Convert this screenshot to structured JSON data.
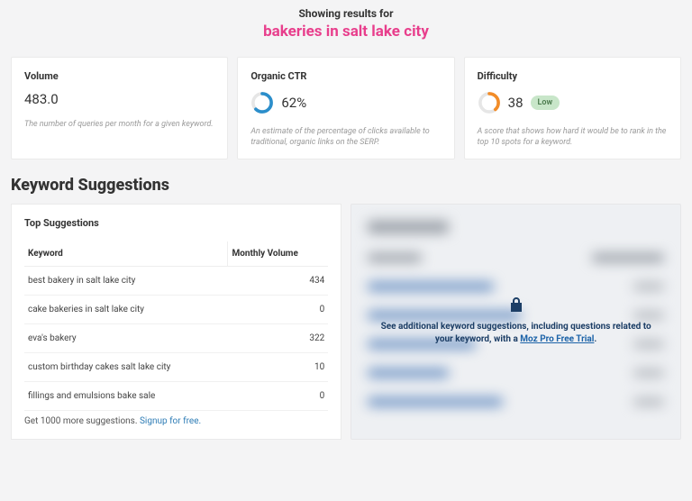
{
  "header": {
    "label": "Showing results for",
    "query": "bakeries in salt lake city"
  },
  "metrics": {
    "volume": {
      "title": "Volume",
      "value": "483.0",
      "desc": "The number of queries per month for a given keyword."
    },
    "ctr": {
      "title": "Organic CTR",
      "value": "62%",
      "percent": 62,
      "desc": "An estimate of the percentage of clicks available to traditional, organic links on the SERP.",
      "color": "#2b8ecb"
    },
    "difficulty": {
      "title": "Difficulty",
      "value": "38",
      "percent": 38,
      "pill": "Low",
      "desc": "A score that shows how hard it would be to rank in the top 10 spots for a keyword.",
      "color": "#f28c28"
    }
  },
  "suggestions": {
    "section_title": "Keyword Suggestions",
    "panel_title": "Top Suggestions",
    "col_keyword": "Keyword",
    "col_volume": "Monthly Volume",
    "rows": [
      {
        "kw": "best bakery in salt lake city",
        "vol": "434"
      },
      {
        "kw": "cake bakeries in salt lake city",
        "vol": "0"
      },
      {
        "kw": "eva's bakery",
        "vol": "322"
      },
      {
        "kw": "custom birthday cakes salt lake city",
        "vol": "10"
      },
      {
        "kw": "fillings and emulsions bake sale",
        "vol": "0"
      }
    ],
    "cta_text": "Get 1000 more suggestions. ",
    "cta_link": "Signup for free."
  },
  "locked": {
    "text_a": "See additional keyword suggestions, including questions related to your keyword, with a ",
    "text_link": "Moz Pro Free Trial",
    "text_b": "."
  }
}
